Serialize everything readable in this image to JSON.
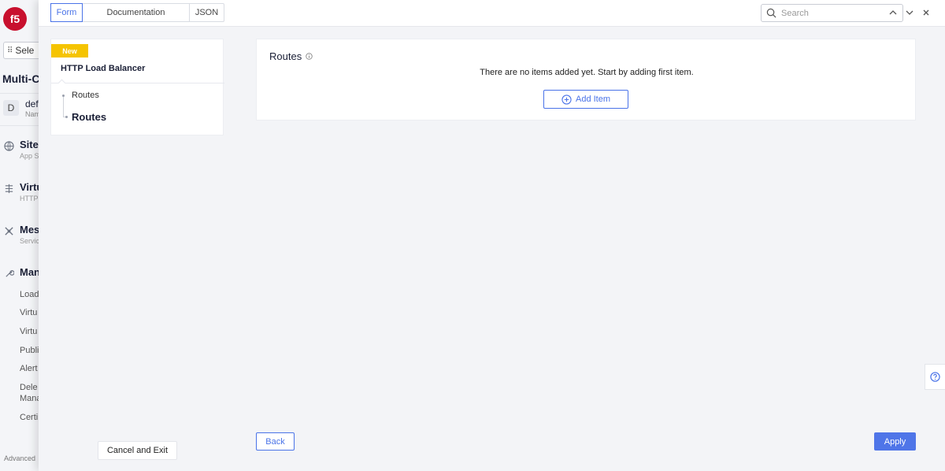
{
  "background_app": {
    "logo_text": "f5",
    "select_label": "Sele",
    "title": "Multi-C",
    "namespace": {
      "avatar": "D",
      "name": "def",
      "sub": "Nam"
    },
    "nav": [
      {
        "icon": "globe-icon",
        "label": "Sites",
        "sub": "App S"
      },
      {
        "icon": "virtual-host-icon",
        "label": "Virtu",
        "sub": "HTTP"
      },
      {
        "icon": "mesh-icon",
        "label": "Mes",
        "sub": "Servic"
      },
      {
        "icon": "wrench-icon",
        "label": "Man",
        "sub": ""
      }
    ],
    "sub_items": [
      "Load",
      "Virtu",
      "Virtu",
      "Publi",
      "Alert",
      "Dele",
      "Mana",
      "Certi"
    ],
    "advanced": "Advanced"
  },
  "tabs": [
    {
      "label": "Form",
      "active": true
    },
    {
      "label": "Documentation",
      "active": false
    },
    {
      "label": "JSON",
      "active": false
    }
  ],
  "search": {
    "placeholder": "Search",
    "value": ""
  },
  "form_nav": {
    "badge": "New",
    "title": "HTTP Load Balancer",
    "items": [
      {
        "label": "Routes",
        "current": false
      },
      {
        "label": "Routes",
        "current": true
      }
    ]
  },
  "routes_section": {
    "title": "Routes",
    "info_icon": "info-icon",
    "empty_message": "There are no items added yet. Start by adding first item.",
    "add_button": "Add Item"
  },
  "footer": {
    "cancel": "Cancel and Exit",
    "back": "Back",
    "apply": "Apply"
  },
  "colors": {
    "accent": "#4a73e8",
    "badge": "#f5c400",
    "logo": "#c8102e",
    "apply_bg": "#4f75e8"
  }
}
